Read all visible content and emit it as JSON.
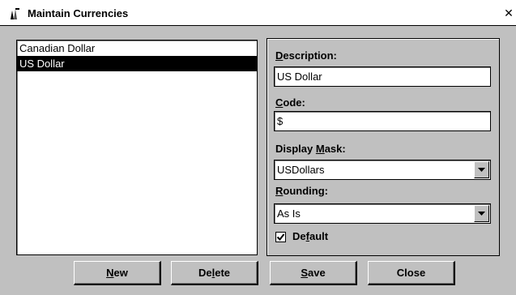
{
  "window": {
    "title": "Maintain Currencies",
    "close_glyph": "✕"
  },
  "currency_list": {
    "items": [
      {
        "label": "Canadian Dollar",
        "selected": false
      },
      {
        "label": "US Dollar",
        "selected": true
      }
    ]
  },
  "details": {
    "description": {
      "label_key": "D",
      "label_rest": "escription:",
      "value": "US Dollar"
    },
    "code": {
      "label_key": "C",
      "label_rest": "ode:",
      "value": "$"
    },
    "display_mask": {
      "label_pre": "Display ",
      "label_key": "M",
      "label_rest": "ask:",
      "value": "USDollars"
    },
    "rounding": {
      "label_key": "R",
      "label_rest": "ounding:",
      "value": "As Is"
    },
    "default": {
      "label_pre": "De",
      "label_key": "f",
      "label_rest": "ault",
      "checked": true
    }
  },
  "buttons": {
    "new": {
      "key": "N",
      "rest": "ew"
    },
    "delete": {
      "pre": "De",
      "key": "l",
      "rest": "ete"
    },
    "save": {
      "key": "S",
      "rest": "ave"
    },
    "close": {
      "label": "Close"
    }
  },
  "icons": {
    "title_icon": "app-icon",
    "close_icon": "close-icon",
    "dropdown_icon": "chevron-down-icon",
    "check_icon": "check-icon"
  },
  "colors": {
    "face": "#c0c0c0",
    "selection_bg": "#000000",
    "selection_fg": "#ffffff"
  }
}
